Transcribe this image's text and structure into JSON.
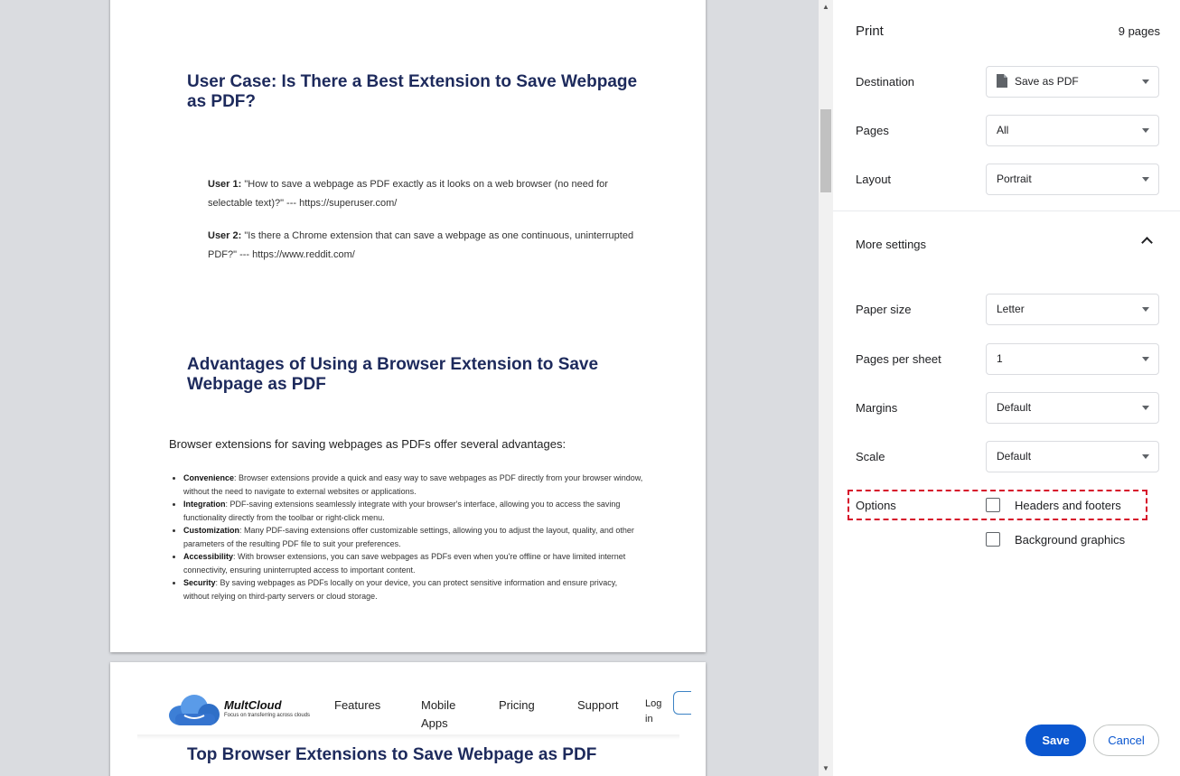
{
  "preview": {
    "page1": {
      "heading1": "User Case: Is There a Best Extension to Save Webpage as PDF?",
      "user1_label": "User 1:",
      "user1_text": " \"How to save a webpage as PDF exactly as it looks on a web browser (no need for selectable text)?\" --- https://superuser.com/",
      "user2_label": "User 2:",
      "user2_text": " \"Is there a Chrome extension that can save a webpage as one continuous, uninterrupted PDF?\" --- https://www.reddit.com/",
      "heading2": "Advantages of Using a Browser Extension to Save Webpage as PDF",
      "intro": "Browser extensions for saving webpages as PDFs offer several advantages:",
      "advantages": [
        {
          "term": "Convenience",
          "text": ": Browser extensions provide a quick and easy way to save webpages as PDF directly from your browser window, without the need to navigate to external websites or applications."
        },
        {
          "term": "Integration",
          "text": ": PDF-saving extensions seamlessly integrate with your browser's interface, allowing you to access the saving functionality directly from the toolbar or right-click menu."
        },
        {
          "term": "Customization",
          "text": ": Many PDF-saving extensions offer customizable settings, allowing you to adjust the layout, quality, and other parameters of the resulting PDF file to suit your preferences."
        },
        {
          "term": "Accessibility",
          "text": ": With browser extensions, you can save webpages as PDFs even when you're offline or have limited internet connectivity, ensuring uninterrupted access to important content."
        },
        {
          "term": "Security",
          "text": ": By saving webpages as PDFs locally on your device, you can protect sensitive information and ensure privacy, without relying on third-party servers or cloud storage."
        }
      ]
    },
    "page2": {
      "brand": "MultCloud",
      "tagline": "Focus on transferring across clouds",
      "nav": [
        "Features",
        "Mobile Apps",
        "Pricing",
        "Support",
        "Log in"
      ],
      "heading": "Top Browser Extensions to Save Webpage as PDF"
    }
  },
  "settings": {
    "title": "Print",
    "page_count": "9 pages",
    "destination": {
      "label": "Destination",
      "value": "Save as PDF",
      "icon": "document-icon"
    },
    "pages": {
      "label": "Pages",
      "value": "All"
    },
    "layout": {
      "label": "Layout",
      "value": "Portrait"
    },
    "more_settings": "More settings",
    "paper_size": {
      "label": "Paper size",
      "value": "Letter"
    },
    "pages_per_sheet": {
      "label": "Pages per sheet",
      "value": "1"
    },
    "margins": {
      "label": "Margins",
      "value": "Default"
    },
    "scale": {
      "label": "Scale",
      "value": "Default"
    },
    "options": {
      "label": "Options",
      "headers_footers": {
        "label": "Headers and footers",
        "checked": false
      },
      "background_graphics": {
        "label": "Background graphics",
        "checked": false
      }
    },
    "save_label": "Save",
    "cancel_label": "Cancel"
  },
  "colors": {
    "accent": "#0b57d0",
    "heading": "#1d2a5c",
    "highlight": "#d6112a"
  }
}
